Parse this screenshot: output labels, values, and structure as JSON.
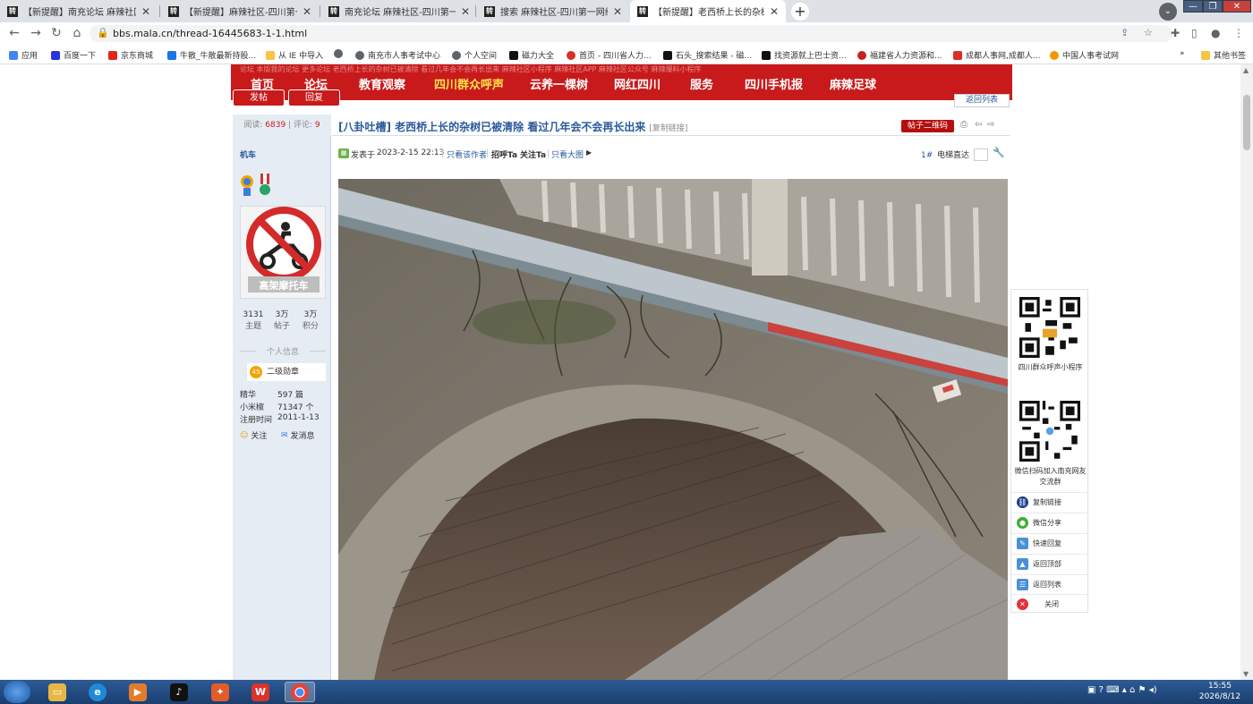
{
  "browser": {
    "tabs": [
      {
        "label": "【新提醒】南充论坛 麻辣社区-四",
        "active": false
      },
      {
        "label": "【新提醒】麻辣社区-四川第一网",
        "active": false
      },
      {
        "label": "南充论坛 麻辣社区-四川第一网络",
        "active": false
      },
      {
        "label": "搜索 麻辣社区-四川第一网络社区",
        "active": false
      },
      {
        "label": "【新提醒】老西桥上长的杂树已被",
        "active": true
      }
    ],
    "url": "bbs.mala.cn/thread-16445683-1-1.html",
    "bookmarks": [
      {
        "label": "应用",
        "color": "#4285f4"
      },
      {
        "label": "百度一下",
        "color": "#2932e1"
      },
      {
        "label": "京东商城",
        "color": "#e1251b"
      },
      {
        "label": "牛散_牛散最新持股...",
        "color": "#1a73e8"
      },
      {
        "label": "从 IE 中导入",
        "color": "#f6c343"
      },
      {
        "label": "",
        "color": "#5f6368"
      },
      {
        "label": "南充市人事考试中心",
        "color": "#5f6368"
      },
      {
        "label": "个人空间",
        "color": "#5f6368"
      },
      {
        "label": "磁力大全",
        "color": "#111111"
      },
      {
        "label": "首页 - 四川省人力...",
        "color": "#d93025"
      },
      {
        "label": "石头_搜索结果 - 磁...",
        "color": "#111111"
      },
      {
        "label": "找资源就上巴士资...",
        "color": "#111111"
      },
      {
        "label": "福建省人力资源和...",
        "color": "#c5221f"
      },
      {
        "label": "成都人事网,成都人...",
        "color": "#d93025"
      },
      {
        "label": "中国人事考试网",
        "color": "#f29900"
      }
    ],
    "bookmarks_more": "»",
    "other_bookmarks": "其他书签"
  },
  "site": {
    "ghost_text": "论坛     本版我的论坛   更多论坛   老西桥上长的杂树已被清除 看过几年会不会再长出来     麻辣社区小程序   麻辣社区APP   麻辣社区公众号   麻辣爆料小程序",
    "nav": [
      {
        "label": "首页",
        "highlight": false
      },
      {
        "label": "论坛",
        "highlight": false
      },
      {
        "label": "教育观察",
        "highlight": false
      },
      {
        "label": "四川群众呼声",
        "highlight": true
      },
      {
        "label": "云养一棵树",
        "highlight": false
      },
      {
        "label": "网红四川",
        "highlight": false
      },
      {
        "label": "服务",
        "highlight": false
      },
      {
        "label": "四川手机报",
        "highlight": false
      },
      {
        "label": "麻辣足球",
        "highlight": false
      }
    ],
    "post_button": "发帖",
    "reply_button": "回复",
    "back_to_list": "返回列表"
  },
  "thread": {
    "views_label": "阅读:",
    "views": "6839",
    "replies_label": "评论:",
    "replies": "9",
    "title": "[八卦吐槽] 老西桥上长的杂树已被清除 看过几年会不会再长出来",
    "copy_link": "[复制链接]",
    "qr_button": "帖子二维码"
  },
  "post": {
    "posted_label": "发表于",
    "posted_time": "2023-2-15 22:13",
    "only_author": "只看该作者",
    "greet": "招呼Ta",
    "follow": "关注Ta",
    "only_images": "只看大图",
    "floor": "1#",
    "goto_label": "电梯直达"
  },
  "user": {
    "name": "机车",
    "avatar_caption": "高架摩托车",
    "stats": [
      {
        "value": "3131",
        "label": "主题"
      },
      {
        "value": "3万",
        "label": "帖子"
      },
      {
        "value": "3万",
        "label": "积分"
      }
    ],
    "section_title": "个人信息",
    "level_num": "45",
    "level_name": "二级勋章",
    "rows": [
      {
        "label": "精华",
        "value": "597 篇"
      },
      {
        "label": "小米椒",
        "value": "71347 个"
      },
      {
        "label": "注册时间",
        "value": "2011-1-13"
      }
    ],
    "follow": "关注",
    "message": "发消息"
  },
  "float_sidebar": {
    "qr1_caption": "四川群众呼声小程序",
    "qr2_caption": "微信扫码加入南充网友交流群",
    "items": [
      {
        "label": "复制链接",
        "color": "#1c3f8a",
        "glyph": "⛓"
      },
      {
        "label": "微信分享",
        "color": "#3cb034",
        "glyph": "●"
      },
      {
        "label": "快速回复",
        "color": "#4a90d9",
        "glyph": "✎"
      },
      {
        "label": "返回顶部",
        "color": "#4a90d9",
        "glyph": "▲"
      },
      {
        "label": "返回列表",
        "color": "#4a90d9",
        "glyph": "☰"
      },
      {
        "label": "关闭",
        "color": "#e0333a",
        "glyph": "✕"
      }
    ]
  },
  "taskbar": {
    "time": "15:55",
    "date": "2026/8/12"
  }
}
